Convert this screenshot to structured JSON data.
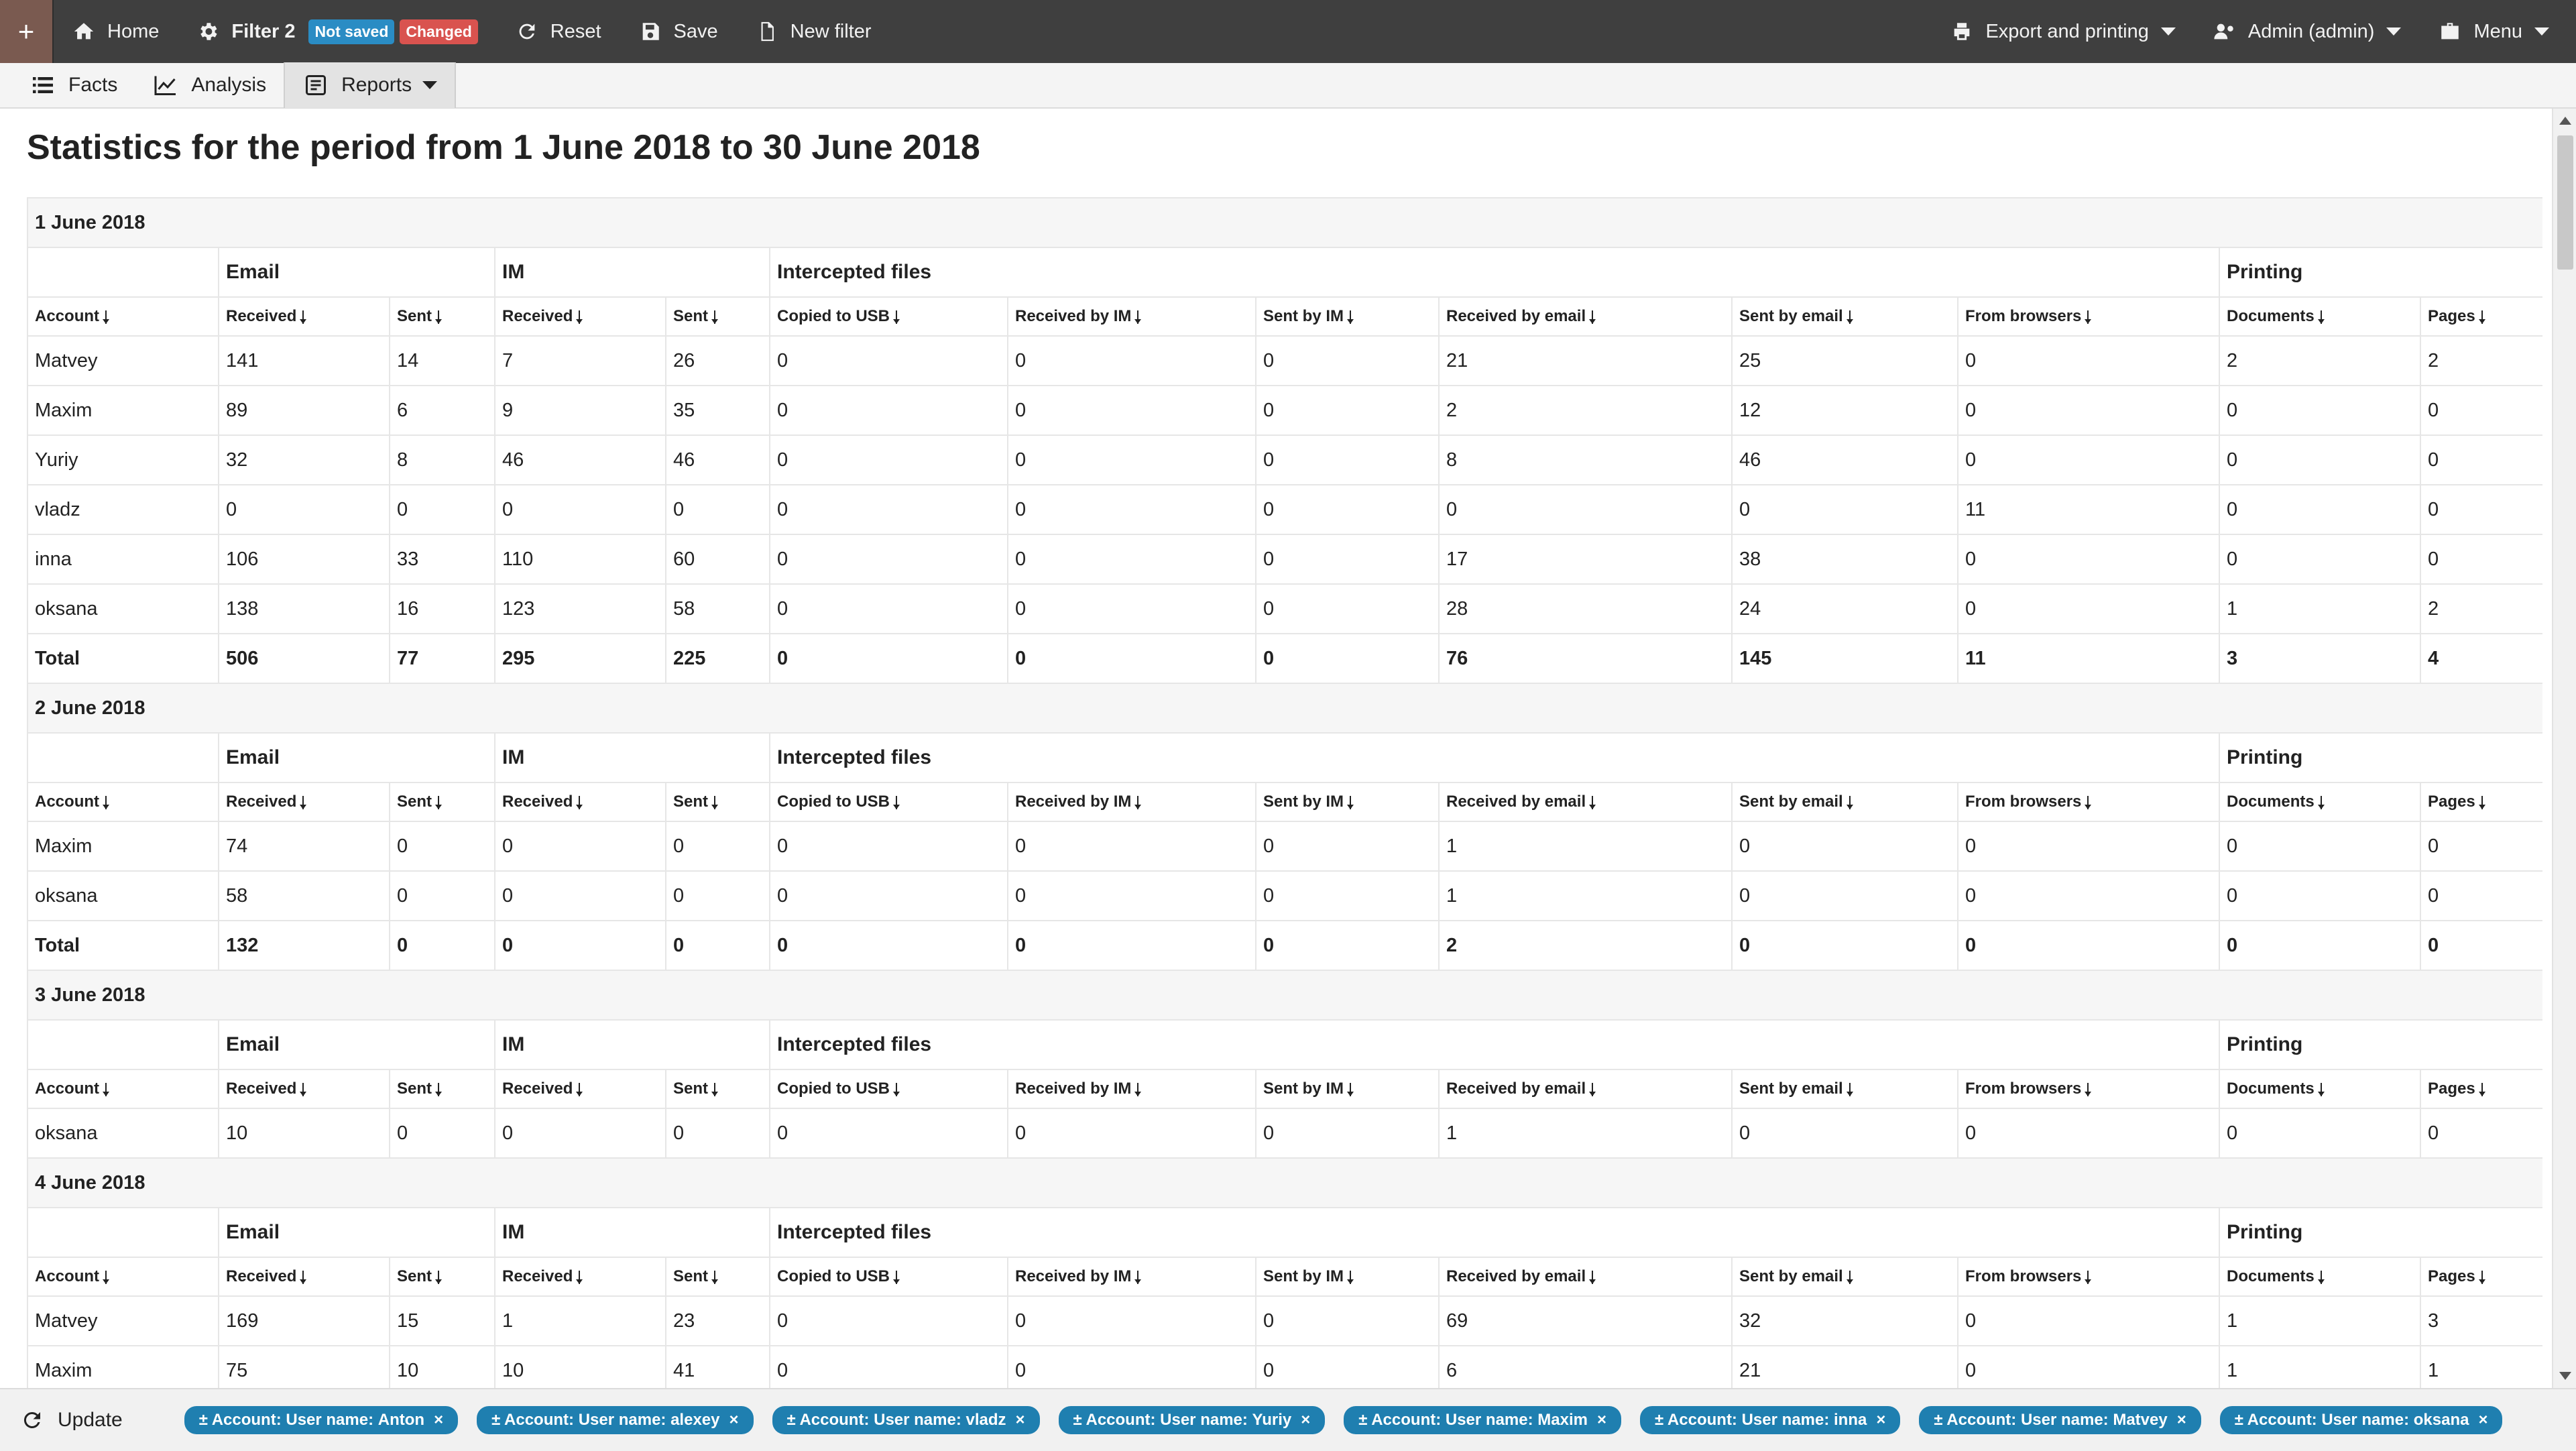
{
  "topbar": {
    "plus": "+",
    "home": "Home",
    "filter": "Filter 2",
    "badge_not_saved": "Not saved",
    "badge_changed": "Changed",
    "reset": "Reset",
    "save": "Save",
    "new_filter": "New filter",
    "export": "Export and printing",
    "admin": "Admin (admin)",
    "menu": "Menu"
  },
  "subbar": {
    "facts": "Facts",
    "analysis": "Analysis",
    "reports": "Reports"
  },
  "title": "Statistics for the period from 1 June 2018 to 30 June 2018",
  "groups": {
    "email": "Email",
    "im": "IM",
    "intercepted": "Intercepted files",
    "printing": "Printing"
  },
  "columns": [
    "Account",
    "Received",
    "Sent",
    "Received",
    "Sent",
    "Copied to USB",
    "Received by IM",
    "Sent by IM",
    "Received by email",
    "Sent by email",
    "From browsers",
    "Documents",
    "Pages"
  ],
  "sections": [
    {
      "date": "1 June 2018",
      "rows": [
        [
          "Matvey",
          "141",
          "14",
          "7",
          "26",
          "0",
          "0",
          "0",
          "21",
          "25",
          "0",
          "2",
          "2"
        ],
        [
          "Maxim",
          "89",
          "6",
          "9",
          "35",
          "0",
          "0",
          "0",
          "2",
          "12",
          "0",
          "0",
          "0"
        ],
        [
          "Yuriy",
          "32",
          "8",
          "46",
          "46",
          "0",
          "0",
          "0",
          "8",
          "46",
          "0",
          "0",
          "0"
        ],
        [
          "vladz",
          "0",
          "0",
          "0",
          "0",
          "0",
          "0",
          "0",
          "0",
          "0",
          "11",
          "0",
          "0"
        ],
        [
          "inna",
          "106",
          "33",
          "110",
          "60",
          "0",
          "0",
          "0",
          "17",
          "38",
          "0",
          "0",
          "0"
        ],
        [
          "oksana",
          "138",
          "16",
          "123",
          "58",
          "0",
          "0",
          "0",
          "28",
          "24",
          "0",
          "1",
          "2"
        ]
      ],
      "total": [
        "Total",
        "506",
        "77",
        "295",
        "225",
        "0",
        "0",
        "0",
        "76",
        "145",
        "11",
        "3",
        "4"
      ]
    },
    {
      "date": "2 June 2018",
      "rows": [
        [
          "Maxim",
          "74",
          "0",
          "0",
          "0",
          "0",
          "0",
          "0",
          "1",
          "0",
          "0",
          "0",
          "0"
        ],
        [
          "oksana",
          "58",
          "0",
          "0",
          "0",
          "0",
          "0",
          "0",
          "1",
          "0",
          "0",
          "0",
          "0"
        ]
      ],
      "total": [
        "Total",
        "132",
        "0",
        "0",
        "0",
        "0",
        "0",
        "0",
        "2",
        "0",
        "0",
        "0",
        "0"
      ]
    },
    {
      "date": "3 June 2018",
      "rows": [
        [
          "oksana",
          "10",
          "0",
          "0",
          "0",
          "0",
          "0",
          "0",
          "1",
          "0",
          "0",
          "0",
          "0"
        ]
      ],
      "total": null
    },
    {
      "date": "4 June 2018",
      "rows": [
        [
          "Matvey",
          "169",
          "15",
          "1",
          "23",
          "0",
          "0",
          "0",
          "69",
          "32",
          "0",
          "1",
          "3"
        ],
        [
          "Maxim",
          "75",
          "10",
          "10",
          "41",
          "0",
          "0",
          "0",
          "6",
          "21",
          "0",
          "1",
          "1"
        ]
      ],
      "total": null
    }
  ],
  "bottombar": {
    "update": "Update",
    "filters": [
      {
        "prefix": "± Account: User name: ",
        "name": "Anton"
      },
      {
        "prefix": "± Account: User name: ",
        "name": "alexey"
      },
      {
        "prefix": "± Account: User name: ",
        "name": "vladz"
      },
      {
        "prefix": "± Account: User name: ",
        "name": "Yuriy"
      },
      {
        "prefix": "± Account: User name: ",
        "name": "Maxim"
      },
      {
        "prefix": "± Account: User name: ",
        "name": "inna"
      },
      {
        "prefix": "± Account: User name: ",
        "name": "Matvey"
      },
      {
        "prefix": "± Account: User name: ",
        "name": "oksana"
      }
    ],
    "remove_glyph": "×"
  }
}
